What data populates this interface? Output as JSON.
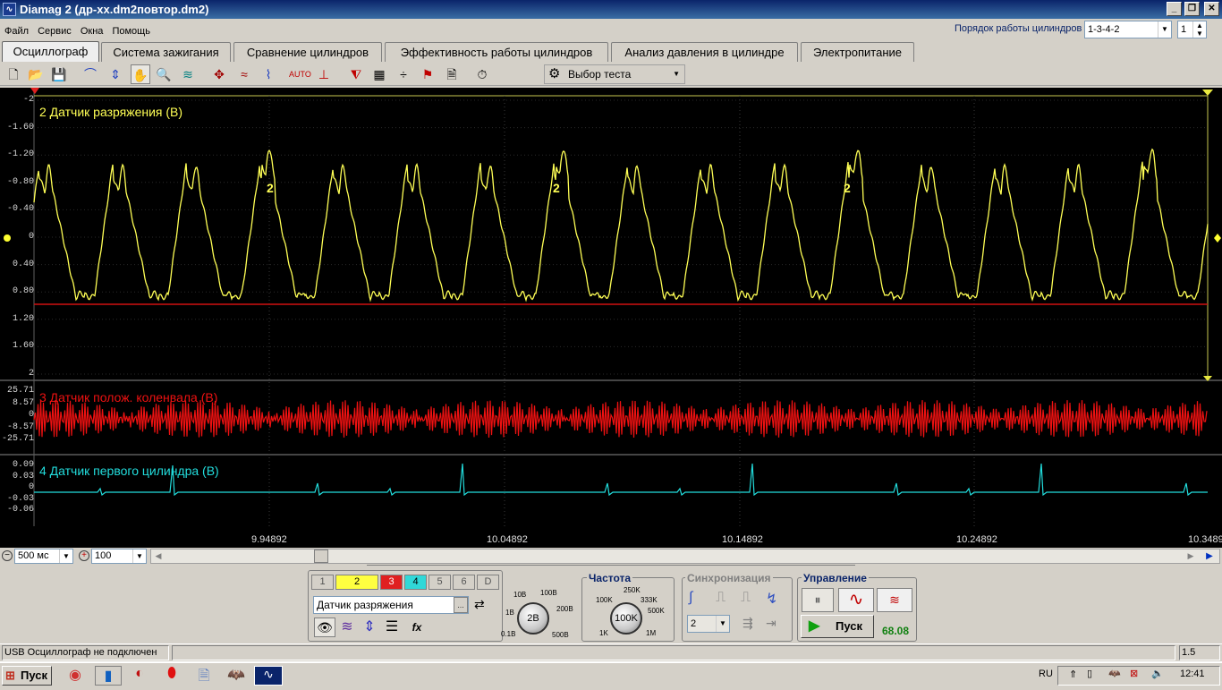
{
  "window": {
    "title": "Diamag 2 (др-хх.dm2повтор.dm2)",
    "icon": "diamag-icon"
  },
  "menu": [
    "Файл",
    "Сервис",
    "Окна",
    "Помощь"
  ],
  "firing_order": {
    "label": "Порядок работы цилиндров",
    "value": "1-3-4-2",
    "cylinder": "1"
  },
  "tabs": [
    "Осциллограф",
    "Система зажигания",
    "Сравнение цилиндров",
    "Эффективность работы цилиндров",
    "Анализ давления в цилиндре",
    "Электропитание"
  ],
  "toolbar": {
    "select_test": "Выбор теста",
    "auto_label": "AUTO"
  },
  "channels": {
    "ch2": {
      "name": "2 Датчик разряжения (В)",
      "color": "#ffff55",
      "ticks": [
        "-2",
        "-1.60",
        "-1.20",
        "-0.80",
        "-0.40",
        "0",
        "0.40",
        "0.80",
        "1.20",
        "1.60",
        "2"
      ],
      "marker": "2"
    },
    "ch3": {
      "name": "3 Датчик полож. коленвала (В)",
      "color": "#ee1111",
      "ticks": [
        "25.71",
        "8.57",
        "0",
        "-8.57",
        "-25.71"
      ]
    },
    "ch4": {
      "name": "4 Датчик первого цилиндра (В)",
      "color": "#22dddd",
      "ticks": [
        "0.09",
        "0.03",
        "0",
        "-0.03",
        "-0.06"
      ]
    }
  },
  "time_axis": [
    "9.94892",
    "10.04892",
    "10.14892",
    "10.24892",
    "10.3489"
  ],
  "timebase": {
    "value": "500 мс",
    "zoom": "100"
  },
  "channel_panel": {
    "buttons": [
      "1",
      "2",
      "3",
      "4",
      "5",
      "6",
      "D"
    ],
    "selected_name": "Датчик разряжения",
    "range_labels": [
      "10В",
      "100В",
      "1В",
      "200В",
      "0.1В",
      "500В"
    ],
    "range": "2В"
  },
  "frequency": {
    "title": "Частота",
    "labels": [
      "250K",
      "100K",
      "333K",
      "500K",
      "1K",
      "1M"
    ],
    "value": "100K"
  },
  "sync": {
    "title": "Синхронизация",
    "channel": "2"
  },
  "control": {
    "title": "Управление",
    "start_label": "Пуск",
    "value": "68.08"
  },
  "status": {
    "text": "USB Осциллограф не подключен",
    "right": "1.5"
  },
  "taskbar": {
    "start": "Пуск",
    "lang": "RU",
    "clock": "12:41"
  }
}
